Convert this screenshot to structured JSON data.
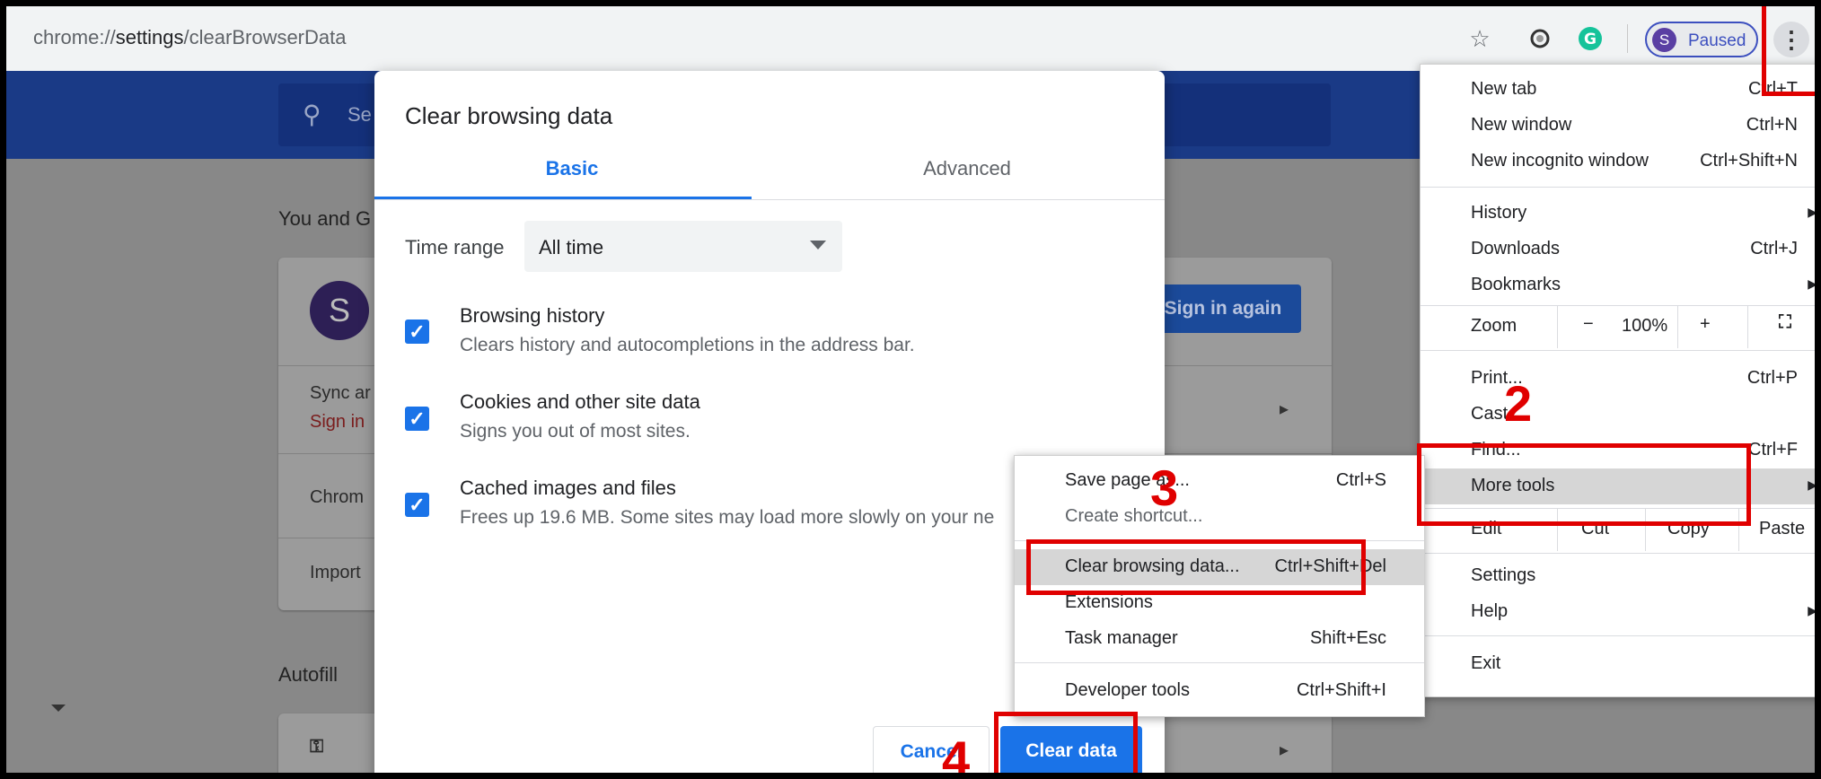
{
  "browser": {
    "url_prefix": "chrome://",
    "url_bold": "settings",
    "url_rest": "/clearBrowserData",
    "profile_initial": "S",
    "profile_status": "Paused",
    "toolbar_icons": [
      "star-icon",
      "extension-circle-icon",
      "grammarly-icon",
      "kebab-menu-icon"
    ]
  },
  "settings_page": {
    "search_icon": "search-icon",
    "search_placeholder_visible": "Se",
    "section_you_and": "You and G",
    "avatar_initial": "S",
    "sign_in_again": "Sign in again",
    "sync_row": "Sync ar",
    "sync_sub": "Sign in",
    "chrome_row": "Chrom",
    "import_row": "Import",
    "section_autofill": "Autofill",
    "key_icon": "key-icon"
  },
  "dialog": {
    "title": "Clear browsing data",
    "tabs": [
      "Basic",
      "Advanced"
    ],
    "time_range_label": "Time range",
    "time_range_value": "All time",
    "items": [
      {
        "title": "Browsing history",
        "desc": "Clears history and autocompletions in the address bar.",
        "checked": true
      },
      {
        "title": "Cookies and other site data",
        "desc": "Signs you out of most sites.",
        "checked": true
      },
      {
        "title": "Cached images and files",
        "desc": "Frees up 19.6 MB. Some sites may load more slowly on your ne",
        "checked": true
      }
    ],
    "cancel": "Cancel",
    "clear": "Clear data"
  },
  "main_menu": {
    "new_tab": {
      "label": "New tab",
      "shortcut": "Ctrl+T"
    },
    "new_window": {
      "label": "New window",
      "shortcut": "Ctrl+N"
    },
    "new_incognito": {
      "label": "New incognito window",
      "shortcut": "Ctrl+Shift+N"
    },
    "history": {
      "label": "History"
    },
    "downloads": {
      "label": "Downloads",
      "shortcut": "Ctrl+J"
    },
    "bookmarks": {
      "label": "Bookmarks"
    },
    "zoom": {
      "label": "Zoom",
      "minus": "−",
      "value": "100%",
      "plus": "+"
    },
    "print": {
      "label": "Print...",
      "shortcut": "Ctrl+P"
    },
    "cast": {
      "label": "Cast..."
    },
    "find": {
      "label": "Find...",
      "shortcut": "Ctrl+F"
    },
    "more_tools": {
      "label": "More tools"
    },
    "edit": {
      "label": "Edit",
      "cut": "Cut",
      "copy": "Copy",
      "paste": "Paste"
    },
    "settings": {
      "label": "Settings"
    },
    "help": {
      "label": "Help"
    },
    "exit": {
      "label": "Exit"
    }
  },
  "more_tools_menu": {
    "save_page": {
      "label": "Save page as...",
      "shortcut": "Ctrl+S"
    },
    "create_shortcut": {
      "label": "Create shortcut..."
    },
    "clear_browsing": {
      "label": "Clear browsing data...",
      "shortcut": "Ctrl+Shift+Del"
    },
    "extensions": {
      "label": "Extensions"
    },
    "task_manager": {
      "label": "Task manager",
      "shortcut": "Shift+Esc"
    },
    "developer_tools": {
      "label": "Developer tools",
      "shortcut": "Ctrl+Shift+I"
    }
  },
  "annotations": {
    "step2": "2",
    "step3": "3",
    "step4": "4",
    "color": "#e00000"
  }
}
